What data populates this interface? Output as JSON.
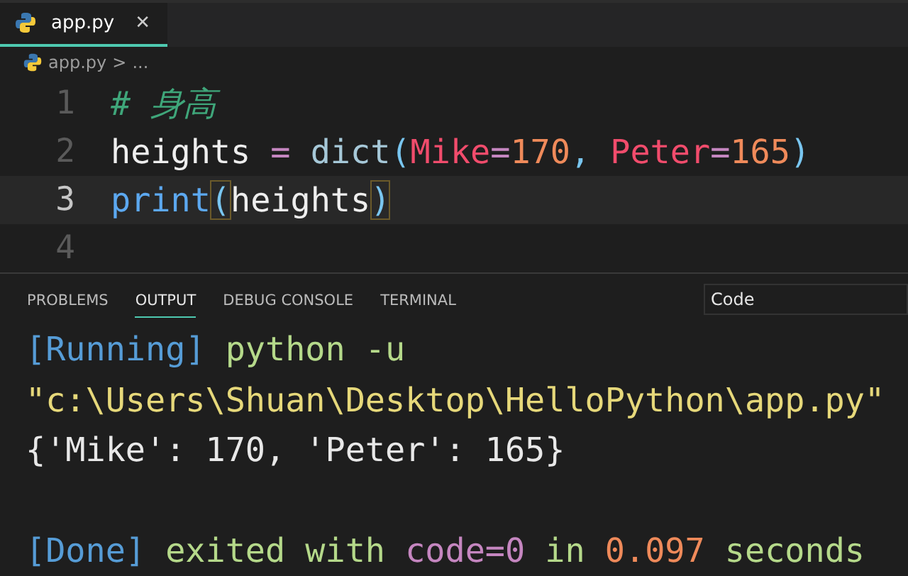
{
  "editor_tabs": [
    {
      "label": "app.py",
      "close": "✕",
      "selected": true
    }
  ],
  "breadcrumb": {
    "file": "app.py",
    "separator": ">",
    "more": "..."
  },
  "code_lines": [
    {
      "number": "1",
      "current": false,
      "tokens": [
        {
          "kind": "comment",
          "text": "# 身高"
        }
      ]
    },
    {
      "number": "2",
      "current": false,
      "tokens": [
        {
          "kind": "ident",
          "text": "heights "
        },
        {
          "kind": "op",
          "text": "= "
        },
        {
          "kind": "builtin",
          "text": "dict"
        },
        {
          "kind": "paren",
          "text": "("
        },
        {
          "kind": "param",
          "text": "Mike"
        },
        {
          "kind": "op",
          "text": "="
        },
        {
          "kind": "number",
          "text": "170"
        },
        {
          "kind": "paren",
          "text": ", "
        },
        {
          "kind": "param",
          "text": "Peter"
        },
        {
          "kind": "op",
          "text": "="
        },
        {
          "kind": "number",
          "text": "165"
        },
        {
          "kind": "paren",
          "text": ")"
        }
      ]
    },
    {
      "number": "3",
      "current": true,
      "tokens": [
        {
          "kind": "func",
          "text": "print"
        },
        {
          "kind": "match",
          "text": "("
        },
        {
          "kind": "ident",
          "text": "heights"
        },
        {
          "kind": "match",
          "text": ")"
        }
      ]
    },
    {
      "number": "4",
      "current": false
    }
  ],
  "panel_tabs": [
    {
      "label": "PROBLEMS",
      "selected": false
    },
    {
      "label": "OUTPUT",
      "selected": true
    },
    {
      "label": "DEBUG CONSOLE",
      "selected": false
    },
    {
      "label": "TERMINAL",
      "selected": false
    }
  ],
  "output_channel": {
    "value": "Code"
  },
  "output_lines": [
    {
      "kind": "text",
      "spans": [
        {
          "kind": "tag",
          "text": "[Running] "
        },
        {
          "kind": "cmd",
          "text": "python -u"
        }
      ]
    },
    {
      "kind": "text",
      "spans": [
        {
          "kind": "string",
          "text": "\"c:\\Users\\Shuan\\Desktop\\HelloPython\\app.py\""
        }
      ]
    },
    {
      "kind": "text",
      "spans": [
        {
          "kind": "plain",
          "text": "{'Mike': 170, 'Peter': 165}"
        }
      ]
    },
    {
      "kind": "blank"
    },
    {
      "kind": "text",
      "spans": [
        {
          "kind": "tag",
          "text": "[Done] "
        },
        {
          "kind": "cmd",
          "text": "exited with "
        },
        {
          "kind": "keyword",
          "text": "code=0"
        },
        {
          "kind": "cmd",
          "text": " in "
        },
        {
          "kind": "number",
          "text": "0.097"
        },
        {
          "kind": "cmd",
          "text": " seconds"
        }
      ]
    }
  ]
}
